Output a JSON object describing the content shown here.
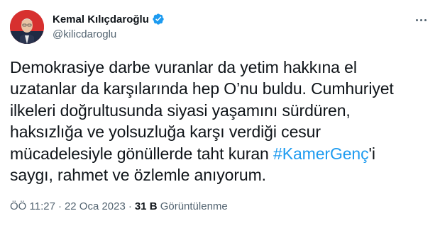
{
  "author": {
    "display_name": "Kemal Kılıçdaroğlu",
    "handle": "@kilicdaroglu",
    "avatar": "profile-photo",
    "verified_icon": "verified-badge-icon",
    "verified_color": "#1d9bf0"
  },
  "more_icon": "more-options-icon",
  "tweet": {
    "text_before": "Demokrasiye darbe vuranlar da yetim hakkına el\nuzatanlar da karşılarında hep O’nu buldu. Cumhuriyet\nilkeleri doğrultusunda siyasi yaşamını sürdüren,\nhaksızlığa ve yolsuzluğa karşı verdiği cesur\nmücadelesiyle gönüllerde taht kuran ",
    "hashtag": "#KamerGenç",
    "text_after": "'i\nsaygı, rahmet ve özlemle anıyorum."
  },
  "meta": {
    "time": "ÖÖ 11:27",
    "separator": "·",
    "date": "22 Oca 2023",
    "views_count": "31 B",
    "views_label": "Görüntülenme"
  },
  "colors": {
    "text": "#0f1419",
    "secondary": "#536471",
    "link": "#1d9bf0"
  }
}
